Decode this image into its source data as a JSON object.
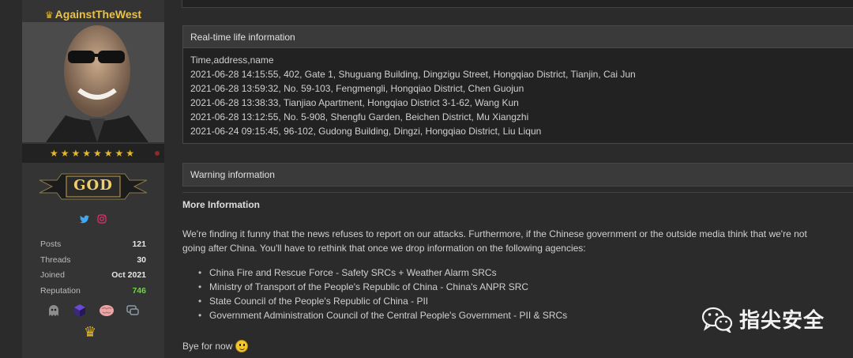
{
  "profile": {
    "username": "AgainstTheWest",
    "rank_label": "GOD",
    "stats": [
      {
        "label": "Posts",
        "value": "121"
      },
      {
        "label": "Threads",
        "value": "30"
      },
      {
        "label": "Joined",
        "value": "Oct 2021"
      },
      {
        "label": "Reputation",
        "value": "746"
      }
    ],
    "star_count": 8,
    "socials": [
      "twitter-icon",
      "instagram-icon"
    ],
    "awards": [
      "ghost-badge-icon",
      "cube-badge-icon",
      "brain-badge-icon",
      "chat-badge-icon",
      "crown-badge-icon"
    ],
    "colors": {
      "username": "#e8c24a",
      "reputation": "#6fd24a",
      "stars": "#e8b923"
    }
  },
  "realtime": {
    "header": "Real-time life information",
    "lines": [
      "Time,address,name",
      "2021-06-28 14:15:55, 402, Gate 1, Shuguang Building, Dingzigu Street, Hongqiao District, Tianjin, Cai Jun",
      "2021-06-28 13:59:32, No. 59-103, Fengmengli, Hongqiao District, Chen Guojun",
      "2021-06-28 13:38:33, Tianjiao Apartment, Hongqiao District 3-1-62, Wang Kun",
      "2021-06-28 13:12:55, No. 5-908, Shengfu Garden, Beichen District, Mu Xiangzhi",
      "2021-06-24 09:15:45, 96-102, Gudong Building, Dingzi, Hongqiao District, Liu Liqun"
    ]
  },
  "warning": {
    "header": "Warning information"
  },
  "more": {
    "title": "More Information",
    "paragraph_line1": "We're finding it funny that the news refuses to report on our attacks. Furthermore, if the Chinese government or the outside media think that we're not",
    "paragraph_line2": "going after China. You'll have to rethink that once we drop information on the following agencies:",
    "agencies": [
      "China Fire and Rescue Force - Safety SRCs + Weather Alarm SRCs",
      "Ministry of Transport of the People's Republic of China - China's ANPR SRC",
      "State Council of the People's Republic of China - PII",
      "Government Administration Council of the Central People's Government - PII & SRCs"
    ],
    "bye": "Bye for now"
  },
  "watermark": {
    "text": "指尖安全"
  }
}
